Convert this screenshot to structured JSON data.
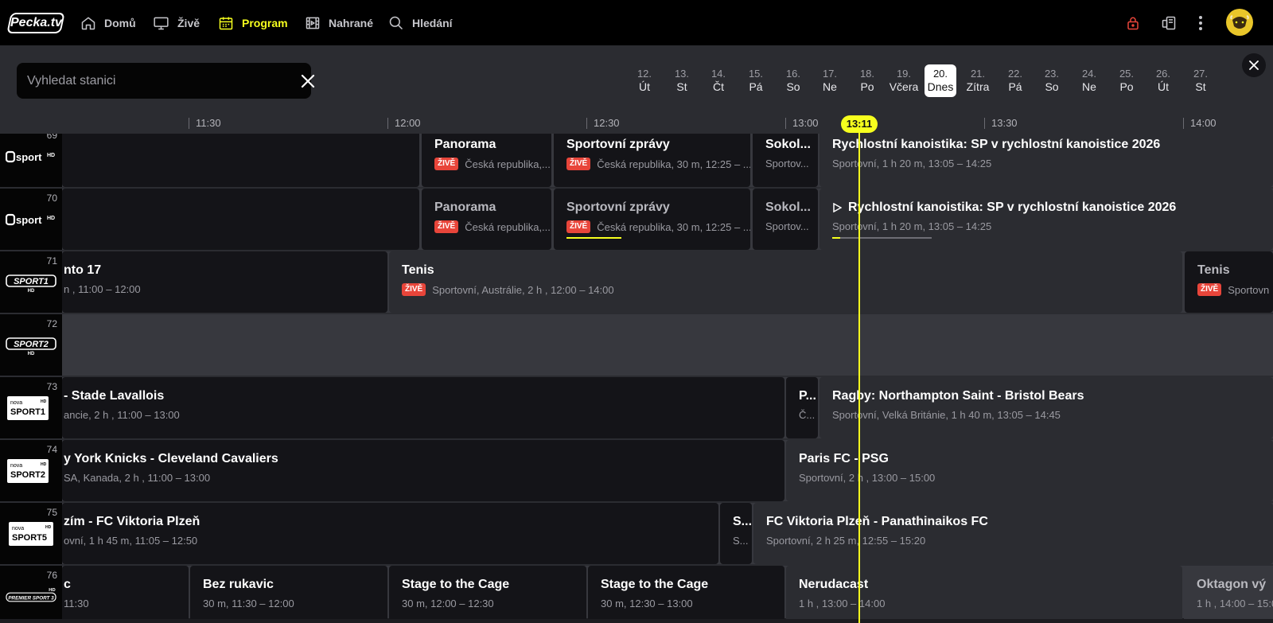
{
  "header": {
    "logo_text": "Pecka.tv",
    "nav": [
      {
        "label": "Domů",
        "icon": "home-icon"
      },
      {
        "label": "Živě",
        "icon": "tv-icon"
      },
      {
        "label": "Program",
        "icon": "calendar-icon",
        "active": true
      },
      {
        "label": "Nahrané",
        "icon": "film-icon"
      },
      {
        "label": "Hledání",
        "icon": "search-icon"
      }
    ],
    "right_icons": [
      "lock-icon",
      "devices-icon",
      "more-vertical-icon"
    ],
    "accent_color": "#f6ff1e",
    "lock_color": "#e8453a"
  },
  "filters": {
    "search_placeholder": "Vyhledat stanici",
    "dates": [
      {
        "day": "12.",
        "weekday": "Út"
      },
      {
        "day": "13.",
        "weekday": "St"
      },
      {
        "day": "14.",
        "weekday": "Čt"
      },
      {
        "day": "15.",
        "weekday": "Pá"
      },
      {
        "day": "16.",
        "weekday": "So"
      },
      {
        "day": "17.",
        "weekday": "Ne"
      },
      {
        "day": "18.",
        "weekday": "Po"
      },
      {
        "day": "19.",
        "weekday": "Včera"
      },
      {
        "day": "20.",
        "weekday": "Dnes",
        "selected": true
      },
      {
        "day": "21.",
        "weekday": "Zítra"
      },
      {
        "day": "22.",
        "weekday": "Pá"
      },
      {
        "day": "23.",
        "weekday": "So"
      },
      {
        "day": "24.",
        "weekday": "Ne"
      },
      {
        "day": "25.",
        "weekday": "Po"
      },
      {
        "day": "26.",
        "weekday": "Út"
      },
      {
        "day": "27.",
        "weekday": "St"
      }
    ]
  },
  "timeline": {
    "labels": [
      "11:30",
      "12:00",
      "12:30",
      "13:00",
      "13:30",
      "14:00"
    ],
    "now": "13:11"
  },
  "live_label": "ŽIVĚ",
  "channels": [
    {
      "number": "69",
      "logo_text": "sport",
      "logo_suffix": "HD",
      "programs": [
        {
          "title": "Panorama",
          "meta": "Česká republika,...",
          "live": true
        },
        {
          "title": "Sportovní zprávy",
          "meta": "Česká republika, 30 m, 12:25 – ...",
          "live": true
        },
        {
          "title": "Sokol...",
          "meta": "Sportov..."
        },
        {
          "title": "Rychlostní kanoistika: SP v rychlostní kanoistice 2026",
          "meta": "Sportovní, 1 h 20 m, 13:05 – 14:25",
          "current": true
        }
      ]
    },
    {
      "number": "70",
      "logo_text": "sport",
      "logo_suffix": "HD",
      "programs": [
        {
          "title": "Panorama",
          "meta": "Česká republika,...",
          "live": true,
          "dim": true
        },
        {
          "title": "Sportovní zprávy",
          "meta": "Česká republika, 30 m, 12:25 – ...",
          "live": true,
          "dim": true,
          "progress": 0.55
        },
        {
          "title": "Sokol...",
          "meta": "Sportov...",
          "dim": true
        },
        {
          "title": "Rychlostní kanoistika: SP v rychlostní kanoistice 2026",
          "meta": "Sportovní, 1 h 20 m, 13:05 – 14:25",
          "current": true,
          "play": true,
          "progress": 0.08
        }
      ]
    },
    {
      "number": "71",
      "logo_text": "SPORT1",
      "logo_suffix": "HD",
      "programs": [
        {
          "title": "nto 17",
          "meta": "n , 11:00 – 12:00"
        },
        {
          "title": "Tenis",
          "meta": "Sportovní, Austrálie, 2 h , 12:00 – 14:00",
          "live": true,
          "current": true
        },
        {
          "title": "Tenis",
          "meta": "Sportovn",
          "live": true,
          "dim": true
        }
      ]
    },
    {
      "number": "72",
      "logo_text": "SPORT2",
      "logo_suffix": "HD",
      "programs": []
    },
    {
      "number": "73",
      "logo_text": "SPORT1",
      "logo_brand": "nova",
      "logo_suffix": "HD",
      "programs": [
        {
          "title": "- Stade Lavallois",
          "meta": "ancie, 2 h , 11:00 – 13:00"
        },
        {
          "title": "P...",
          "meta": "Č..."
        },
        {
          "title": "Ragby: Northampton Saint - Bristol Bears",
          "meta": "Sportovní, Velká Británie, 1 h 40 m, 13:05 – 14:45",
          "current": true
        }
      ]
    },
    {
      "number": "74",
      "logo_text": "SPORT2",
      "logo_brand": "nova",
      "logo_suffix": "HD",
      "programs": [
        {
          "title": "y York Knicks - Cleveland Cavaliers",
          "meta": "SA, Kanada, 2 h , 11:00 – 13:00"
        },
        {
          "title": "Paris FC - PSG",
          "meta": "Sportovní, 2 h , 13:00 – 15:00",
          "current": true
        }
      ]
    },
    {
      "number": "75",
      "logo_text": "SPORT5",
      "logo_brand": "nova",
      "logo_suffix": "HD",
      "programs": [
        {
          "title": "zím - FC Viktoria Plzeň",
          "meta": "ovní, 1 h 45 m, 11:05 – 12:50"
        },
        {
          "title": "S...",
          "meta": "S..."
        },
        {
          "title": "FC Viktoria Plzeň - Panathinaikos FC",
          "meta": "Sportovní, 2 h 25 m, 12:55 – 15:20",
          "current": true
        }
      ]
    },
    {
      "number": "76",
      "logo_text": "PREMIER SPORT 3",
      "logo_suffix": "HD",
      "programs": [
        {
          "title": "c",
          "meta": "11:30"
        },
        {
          "title": "Bez rukavic",
          "meta": "30 m, 11:30 – 12:00"
        },
        {
          "title": "Stage to the Cage",
          "meta": "30 m, 12:00 – 12:30"
        },
        {
          "title": "Stage to the Cage",
          "meta": "30 m, 12:30 – 13:00"
        },
        {
          "title": "Nerudacast",
          "meta": "1 h , 13:00 – 14:00",
          "current": true
        },
        {
          "title": "Oktagon vý",
          "meta": "1 h , 14:00 – 15:00",
          "dim": true
        }
      ]
    }
  ]
}
